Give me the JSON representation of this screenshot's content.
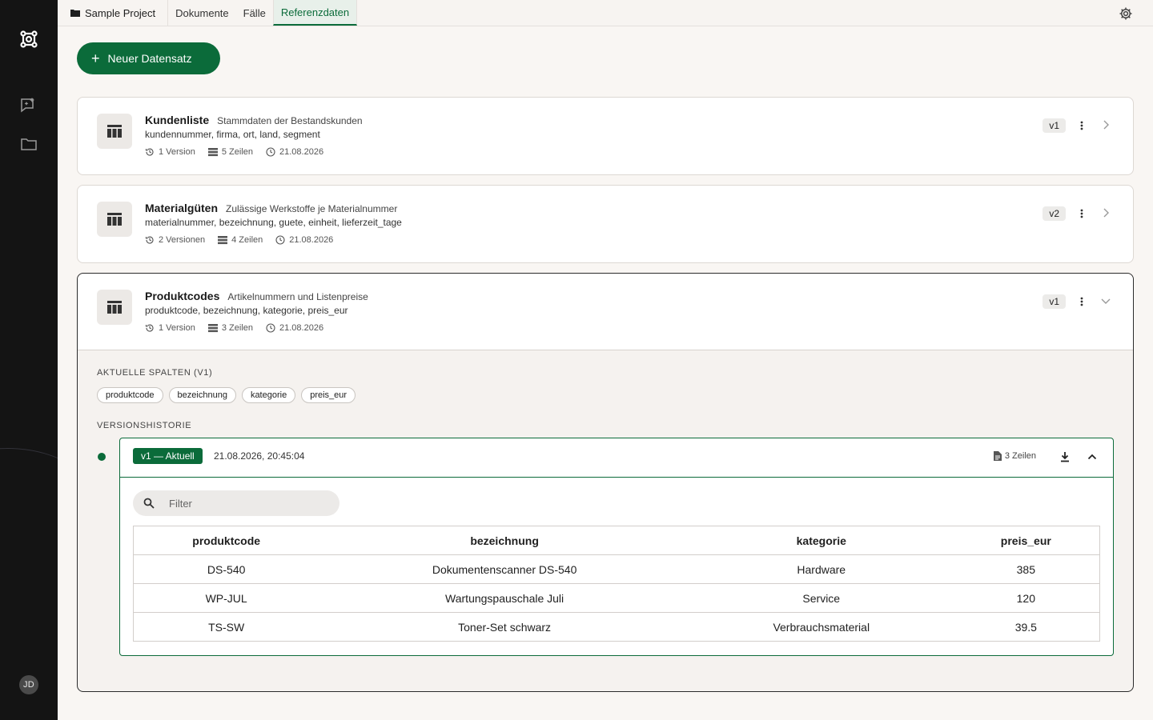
{
  "topbar": {
    "project": "Sample Project",
    "tabs": [
      {
        "label": "Dokumente",
        "active": false
      },
      {
        "label": "Fälle",
        "active": false
      },
      {
        "label": "Referenzdaten",
        "active": true
      }
    ]
  },
  "sidebar": {
    "avatar_initials": "JD"
  },
  "toolbar": {
    "new_label": "Neuer Datensatz"
  },
  "datasets": [
    {
      "title": "Kundenliste",
      "description": "Stammdaten der Bestandskunden",
      "columns": "kundennummer, firma, ort, land, segment",
      "versions": "1 Version",
      "rows": "5 Zeilen",
      "date": "21.08.2026",
      "version_badge": "v1"
    },
    {
      "title": "Materialgüten",
      "description": "Zulässige Werkstoffe je Materialnummer",
      "columns": "materialnummer, bezeichnung, guete, einheit, lieferzeit_tage",
      "versions": "2 Versionen",
      "rows": "4 Zeilen",
      "date": "21.08.2026",
      "version_badge": "v2"
    },
    {
      "title": "Produktcodes",
      "description": "Artikelnummern und Listenpreise",
      "columns": "produktcode, bezeichnung, kategorie, preis_eur",
      "versions": "1 Version",
      "rows": "3 Zeilen",
      "date": "21.08.2026",
      "version_badge": "v1"
    }
  ],
  "detail": {
    "current_columns_label": "AKTUELLE SPALTEN (V1)",
    "chips": [
      "produktcode",
      "bezeichnung",
      "kategorie",
      "preis_eur"
    ],
    "history_label": "VERSIONSHISTORIE",
    "version": {
      "tag": "v1 — Aktuell",
      "timestamp": "21.08.2026, 20:45:04",
      "rows": "3 Zeilen"
    },
    "filter_placeholder": "Filter",
    "table": {
      "headers": [
        "produktcode",
        "bezeichnung",
        "kategorie",
        "preis_eur"
      ],
      "rows": [
        [
          "DS-540",
          "Dokumentenscanner DS-540",
          "Hardware",
          "385"
        ],
        [
          "WP-JUL",
          "Wartungspauschale Juli",
          "Service",
          "120"
        ],
        [
          "TS-SW",
          "Toner-Set schwarz",
          "Verbrauchsmaterial",
          "39.5"
        ]
      ]
    }
  },
  "colors": {
    "accent": "#0b6b3a",
    "rail": "#141414",
    "background": "#f9f6f3"
  }
}
